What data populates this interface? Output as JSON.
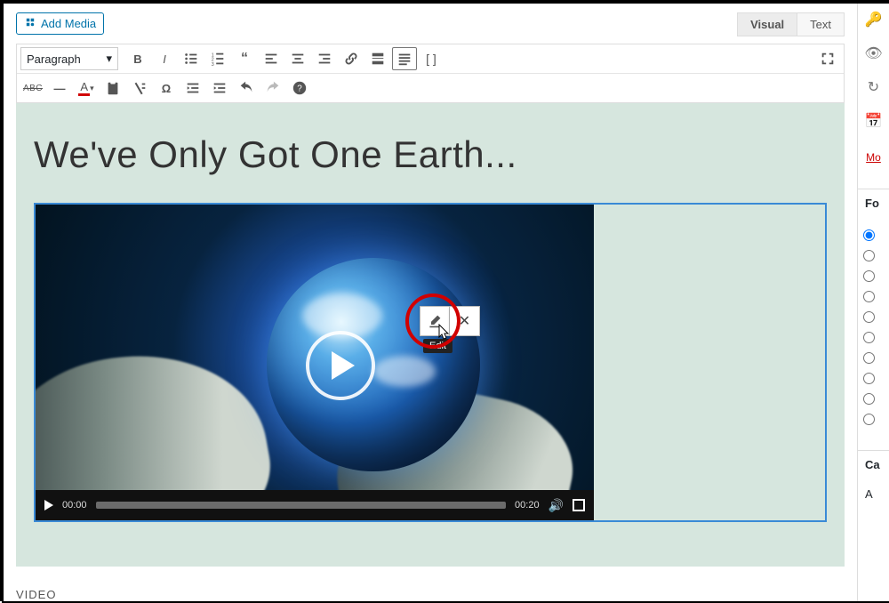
{
  "topbar": {
    "add_media_label": "Add Media",
    "tabs": {
      "visual": "Visual",
      "text": "Text"
    }
  },
  "toolbar": {
    "format_dd": "Paragraph"
  },
  "post": {
    "title": "We've Only Got One Earth...",
    "video": {
      "current_time": "00:00",
      "duration": "00:20"
    },
    "below_label": "VIDEO"
  },
  "popup": {
    "edit_tooltip": "Edit"
  },
  "side": {
    "more_link": "Mo",
    "format_heading": "Fo",
    "categories_heading": "Ca",
    "categories_initial": "A"
  }
}
